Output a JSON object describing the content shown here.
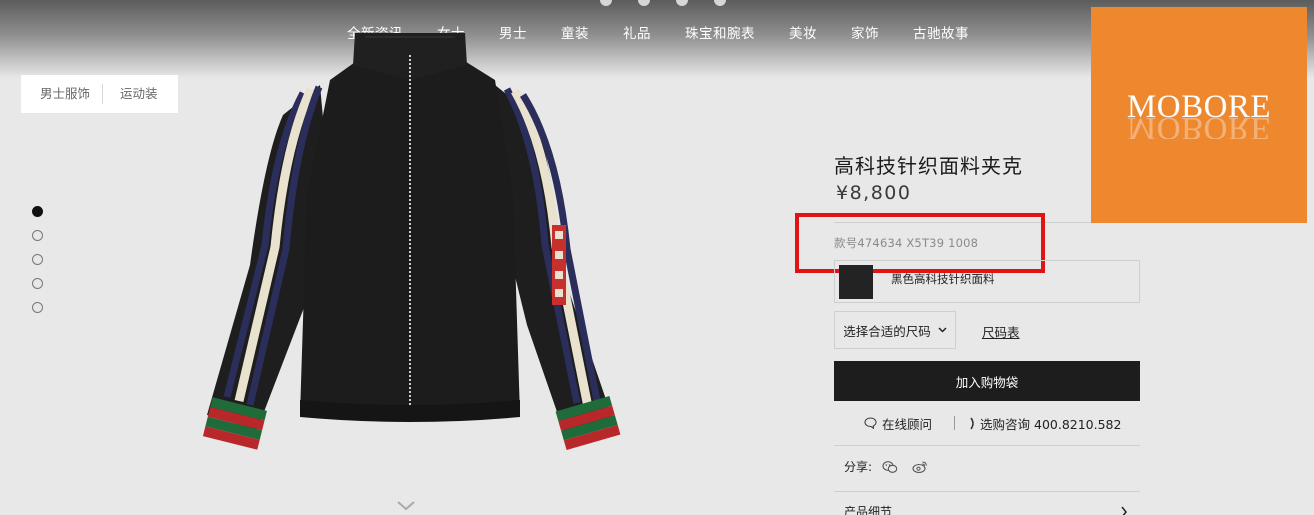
{
  "nav": {
    "items": [
      "全新资讯",
      "女士",
      "男士",
      "童装",
      "礼品",
      "珠宝和腕表",
      "美妆",
      "家饰",
      "古驰故事"
    ]
  },
  "breadcrumb": {
    "item1": "男士服饰",
    "item2": "运动装"
  },
  "gallery": {
    "dot_count": 5,
    "active_index": 0
  },
  "product": {
    "title": "高科技针织面料夹克",
    "price": "¥8,800",
    "sku": "款号474634 X5T39 1008",
    "color_label": "黑色高科技针织面料",
    "size_select": "选择合适的尺码",
    "size_chart": "尺码表",
    "add_to_bag": "加入购物袋",
    "online_advisor": "在线顾问",
    "phone_consult": "选购咨询 400.8210.582",
    "share_label": "分享:",
    "details_label": "产品细节"
  },
  "watermark": {
    "text": "MOBORE"
  },
  "colors": {
    "background": "#e8e8e8",
    "highlight_box": "#e01414",
    "watermark_bg": "#ee882f",
    "button_bg": "#1d1d1d"
  },
  "icons": [
    "chat-bubble-icon",
    "phone-icon",
    "wechat-icon",
    "weibo-icon",
    "chevron-right-icon",
    "chevron-down-icon"
  ]
}
